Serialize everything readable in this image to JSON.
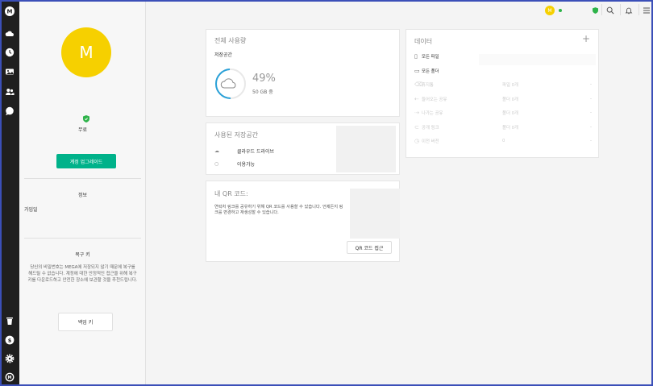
{
  "rail": {
    "icons": [
      "mega-logo-icon",
      "cloud-drive-icon",
      "recents-icon",
      "photos-icon",
      "contacts-icon",
      "chat-icon",
      "rubbish-bin-icon",
      "pro-icon",
      "settings-icon",
      "account-icon"
    ]
  },
  "profile": {
    "avatar_letter": "M",
    "plan": "무료",
    "upgrade_label": "계정 업그레이드",
    "info_title": "정보",
    "joined_label": "가입일",
    "recovery_title": "복구 키",
    "recovery_desc": "당신의 비밀번호는 MEGA에 저장되지 않기 때문에 복구를 해드릴 수 없습니다. 계정에 대한 안정적인 접근을 위해 복구 키를 다운로드하고 안전한 장소에 보관할 것을 추천드립니다.",
    "backup_label": "백업 키"
  },
  "topbar": {
    "avatar_letter": "M",
    "icons": [
      "status-dot-icon",
      "shield-icon",
      "search-icon",
      "notifications-icon",
      "menu-icon"
    ]
  },
  "usage": {
    "title": "전체 사용량",
    "storage_label": "저장공간",
    "percent": 49,
    "percent_label": "49%",
    "of_label": "50 GB 중"
  },
  "used_storage": {
    "title": "사용된 저장공간",
    "rows": [
      {
        "label": "클라우드 드라이브"
      },
      {
        "label": "이용가능"
      }
    ]
  },
  "qr": {
    "title": "내 QR 코드:",
    "desc": "연락처 링크를 공유하기 위해 QR 코드를 사용할 수 있습니다. 언제든지 링크를 변경하고 재생성할 수 있습니다.",
    "button": "QR 코드 접근"
  },
  "data": {
    "title": "데이터",
    "add": "+",
    "rows": [
      {
        "icon": "file-icon",
        "name": "모든 파일",
        "value": "",
        "dash": ""
      },
      {
        "icon": "folder-icon",
        "name": "모든 폴더",
        "value": "",
        "dash": ""
      },
      {
        "icon": "rubbish-icon",
        "name": "휴지통",
        "value": "파일 0개",
        "dash": "-"
      },
      {
        "icon": "incoming-share-icon",
        "name": "들어오는 공유",
        "value": "폴더 0개",
        "dash": "-"
      },
      {
        "icon": "outgoing-share-icon",
        "name": "나가는 공유",
        "value": "폴더 0개",
        "dash": "-"
      },
      {
        "icon": "public-link-icon",
        "name": "공개 링크",
        "value": "폴더 0개",
        "dash": "-"
      },
      {
        "icon": "previous-versions-icon",
        "name": "이전 버전",
        "value": "0",
        "dash": "-"
      }
    ]
  },
  "colors": {
    "rail": "#1f1f1f",
    "avatar": "#f6d000",
    "accent": "#00b28a",
    "gauge": "#2aa1d8",
    "frame": "#3b4fb8"
  }
}
